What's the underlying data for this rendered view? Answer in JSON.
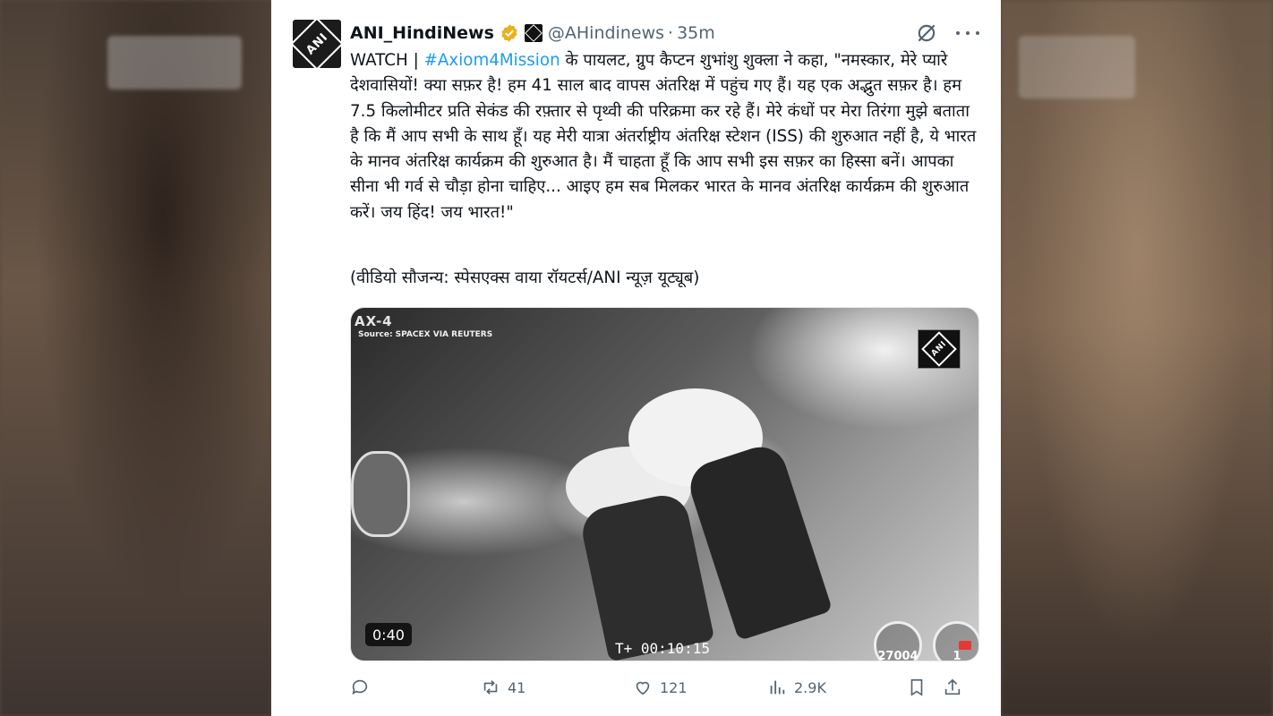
{
  "tweet": {
    "author_name": "ANI_HindiNews",
    "handle": "@AHindinews",
    "separator": "·",
    "time": "35m",
    "avatar_text": "ANI",
    "body_prefix": "WATCH | ",
    "hashtag": "#Axiom4Mission",
    "body_rest": " के पायलट, ग्रुप कैप्टन शुभांशु शुक्ला ने कहा, \"नमस्कार, मेरे प्यारे देशवासियों! क्या सफ़र है! हम 41 साल बाद वापस अंतरिक्ष में पहुंच गए हैं। यह एक अद्भुत सफ़र है। हम 7.5 किलोमीटर प्रति सेकंड की रफ़्तार से पृथ्वी की परिक्रमा कर रहे हैं। मेरे कंधों पर मेरा तिरंगा मुझे बताता है कि मैं आप सभी के साथ हूँ। यह मेरी यात्रा अंतर्राष्ट्रीय अंतरिक्ष स्टेशन (ISS) की शुरुआत नहीं है, ये भारत के मानव अंतरिक्ष कार्यक्रम की शुरुआत है। मैं चाहता हूँ कि आप सभी इस सफ़र का हिस्सा बनें। आपका सीना भी गर्व से चौड़ा होना चाहिए... आइए हम सब मिलकर भारत के मानव अंतरिक्ष कार्यक्रम की शुरुआत करें। जय हिंद! जय भारत!\"",
    "credit": "(वीडियो सौजन्य: स्पेसएक्स वाया रॉयटर्स/ANI न्यूज़ यूट्यूब)"
  },
  "video": {
    "title": "AX-4",
    "source": "Source: SPACEX VIA REUTERS",
    "logo_text": "ANI",
    "hud_time": "T+ 00:10:15",
    "speed": "27004",
    "altitude": "1",
    "duration": "0:40"
  },
  "actions": {
    "reply_count": "",
    "retweet_count": "41",
    "like_count": "121",
    "views_count": "2.9K"
  },
  "colors": {
    "accent": "#1d9bf0",
    "muted": "#536471",
    "verified": "#e8b21b"
  }
}
